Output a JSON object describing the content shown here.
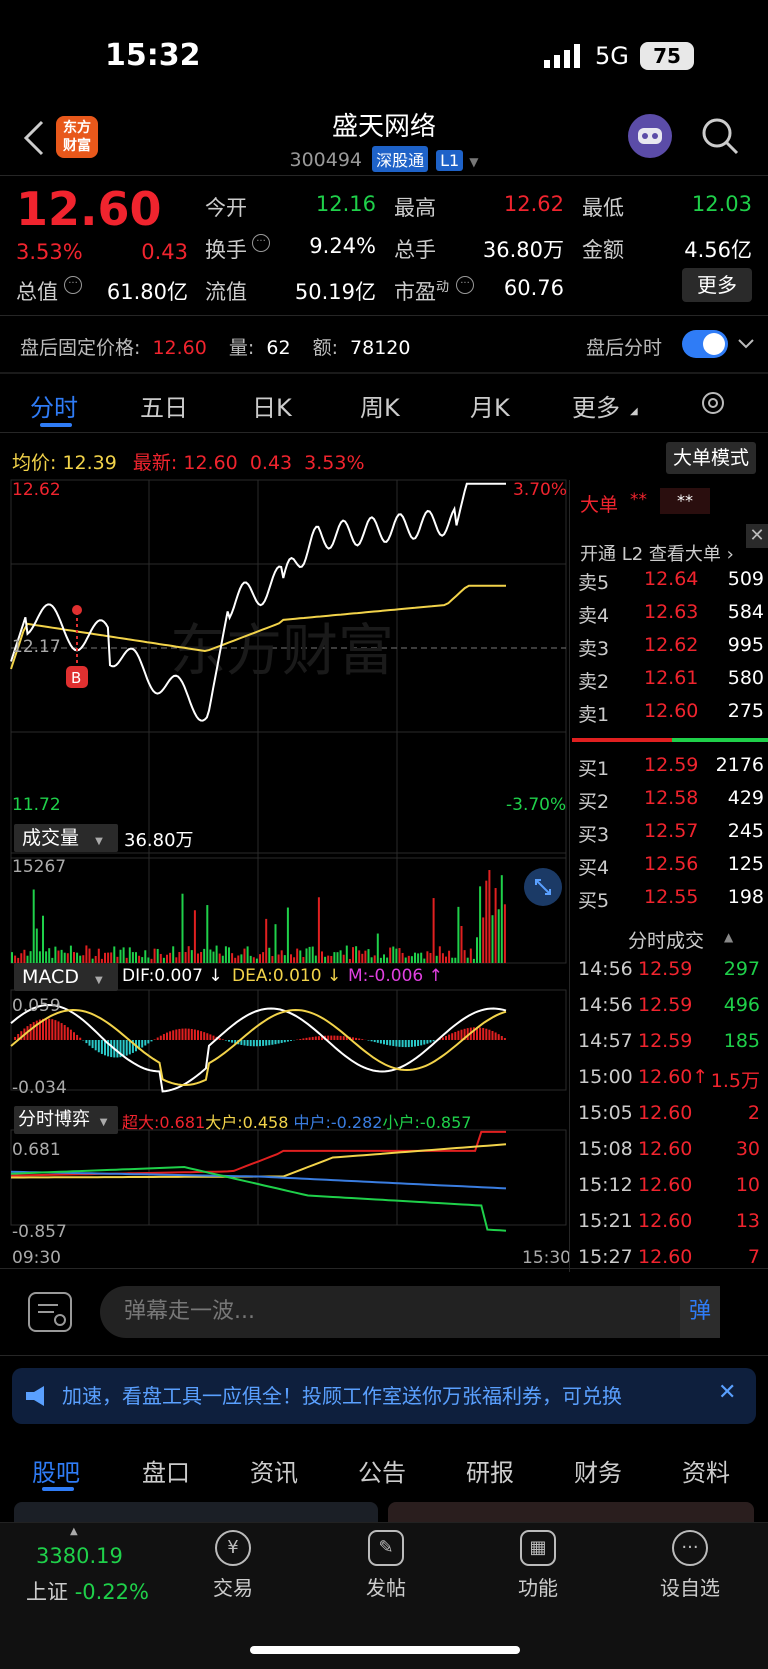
{
  "status": {
    "time": "15:32",
    "network": "5G",
    "battery": "75"
  },
  "header": {
    "logo": "东方\n财富",
    "name": "盛天网络",
    "code": "300494",
    "tag1": "深股通",
    "tag2": "L1"
  },
  "quote": {
    "price": "12.60",
    "pct": "3.53%",
    "chg": "0.43",
    "open_label": "今开",
    "open": "12.16",
    "high_label": "最高",
    "high": "12.62",
    "low_label": "最低",
    "low": "12.03",
    "turnover_label": "换手",
    "turnover": "9.24%",
    "volume_label": "总手",
    "volume": "36.80万",
    "amount_label": "金额",
    "amount": "4.56亿",
    "mktcap_label": "总值",
    "mktcap": "61.80亿",
    "float_label": "流值",
    "float": "50.19亿",
    "pe_label": "市盈",
    "pe_sup": "动",
    "pe": "60.76",
    "more": "更多"
  },
  "after_hours": {
    "label": "盘后固定价格:",
    "price": "12.60",
    "vol_label": "量:",
    "vol": "62",
    "amt_label": "额:",
    "amt": "78120",
    "toggle_label": "盘后分时"
  },
  "tabs": [
    "分时",
    "五日",
    "日K",
    "周K",
    "月K",
    "更多"
  ],
  "intraday": {
    "avg_label": "均价:",
    "avg": "12.39",
    "last_label": "最新:",
    "last": "12.60",
    "last_chg": "0.43",
    "last_pct": "3.53%",
    "mode_btn": "大单模式",
    "y_top": "12.62",
    "y_mid": "12.17",
    "y_bot": "11.72",
    "pct_top": "3.70%",
    "pct_bot": "-3.70%",
    "marker": "B",
    "watermark": "东方财富",
    "vol_selector": "成交量",
    "vol_total": "36.80万",
    "vol_max": "15267",
    "macd_selector": "MACD",
    "dif": "DIF:0.007 ↓",
    "dea": "DEA:0.010 ↓",
    "m": "M:-0.006 ↑",
    "macd_top": "0.059",
    "macd_bot": "-0.034",
    "game_selector": "分时博弈",
    "super": "超大:0.681",
    "large": "大户:0.458",
    "mid": "中户:-0.282",
    "small": "小户:-0.857",
    "game_top": "0.681",
    "game_bot": "-0.857",
    "t_start": "09:30",
    "t_end": "15:30",
    "colors": {
      "price": "#ffffff",
      "avg": "#f2d34a",
      "super": "#e02020",
      "large": "#f2d34a",
      "mid": "#3a7de0",
      "small": "#1fd04a"
    }
  },
  "orderbook": {
    "title": "大单",
    "stars": "**",
    "stars2": "**",
    "l2": "开通 L2 查看大单 ›",
    "asks": [
      {
        "label": "卖5",
        "price": "12.64",
        "vol": "509"
      },
      {
        "label": "卖4",
        "price": "12.63",
        "vol": "584"
      },
      {
        "label": "卖3",
        "price": "12.62",
        "vol": "995"
      },
      {
        "label": "卖2",
        "price": "12.61",
        "vol": "580"
      },
      {
        "label": "卖1",
        "price": "12.60",
        "vol": "275"
      }
    ],
    "bids": [
      {
        "label": "买1",
        "price": "12.59",
        "vol": "2176"
      },
      {
        "label": "买2",
        "price": "12.58",
        "vol": "429"
      },
      {
        "label": "买3",
        "price": "12.57",
        "vol": "245"
      },
      {
        "label": "买4",
        "price": "12.56",
        "vol": "125"
      },
      {
        "label": "买5",
        "price": "12.55",
        "vol": "198"
      }
    ]
  },
  "trades": {
    "title": "分时成交",
    "rows": [
      {
        "time": "14:56",
        "price": "12.59",
        "vol": "297",
        "side": "buy"
      },
      {
        "time": "14:56",
        "price": "12.59",
        "vol": "496",
        "side": "buy"
      },
      {
        "time": "14:57",
        "price": "12.59",
        "vol": "185",
        "side": "buy"
      },
      {
        "time": "15:00",
        "price": "12.60↑",
        "vol": "1.5万",
        "side": "sell"
      },
      {
        "time": "15:05",
        "price": "12.60",
        "vol": "2",
        "side": "sell"
      },
      {
        "time": "15:08",
        "price": "12.60",
        "vol": "30",
        "side": "sell"
      },
      {
        "time": "15:12",
        "price": "12.60",
        "vol": "10",
        "side": "sell"
      },
      {
        "time": "15:21",
        "price": "12.60",
        "vol": "13",
        "side": "sell"
      },
      {
        "time": "15:27",
        "price": "12.60",
        "vol": "7",
        "side": "sell"
      }
    ]
  },
  "danmu": {
    "placeholder": "弹幕走一波...",
    "btn": "弹"
  },
  "notice": "加速，看盘工具一应俱全！投顾工作室送你万张福利券，可兑换",
  "bottom_tabs": [
    "股吧",
    "盘口",
    "资讯",
    "公告",
    "研报",
    "财务",
    "资料"
  ],
  "bottom_bar": {
    "index_value": "3380.19",
    "index_name": "上证",
    "index_pct": "-0.22%",
    "items": [
      "交易",
      "发帖",
      "功能",
      "设自选"
    ]
  }
}
